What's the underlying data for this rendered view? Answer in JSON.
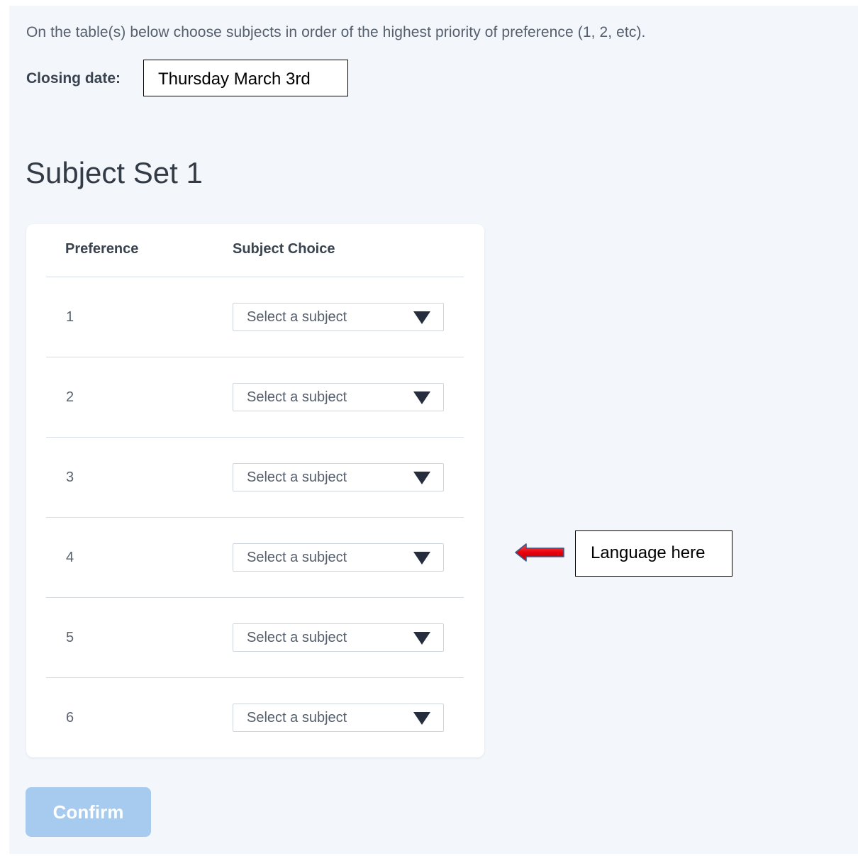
{
  "instructions": "On the table(s) below choose subjects in order of the highest priority of preference (1, 2, etc).",
  "closing": {
    "label": "Closing date:",
    "value": "Thursday March 3rd"
  },
  "subject_set": {
    "title": "Subject Set 1",
    "headers": {
      "preference": "Preference",
      "subject_choice": "Subject Choice"
    },
    "rows": [
      {
        "preference": "1",
        "placeholder": "Select a subject"
      },
      {
        "preference": "2",
        "placeholder": "Select a subject"
      },
      {
        "preference": "3",
        "placeholder": "Select a subject"
      },
      {
        "preference": "4",
        "placeholder": "Select a subject"
      },
      {
        "preference": "5",
        "placeholder": "Select a subject"
      },
      {
        "preference": "6",
        "placeholder": "Select a subject"
      }
    ]
  },
  "annotation": {
    "text": "Language here",
    "arrow_icon": "left-arrow-icon",
    "arrow_color": "#e8000b"
  },
  "confirm_button": {
    "label": "Confirm",
    "color": "#a7cbee"
  }
}
